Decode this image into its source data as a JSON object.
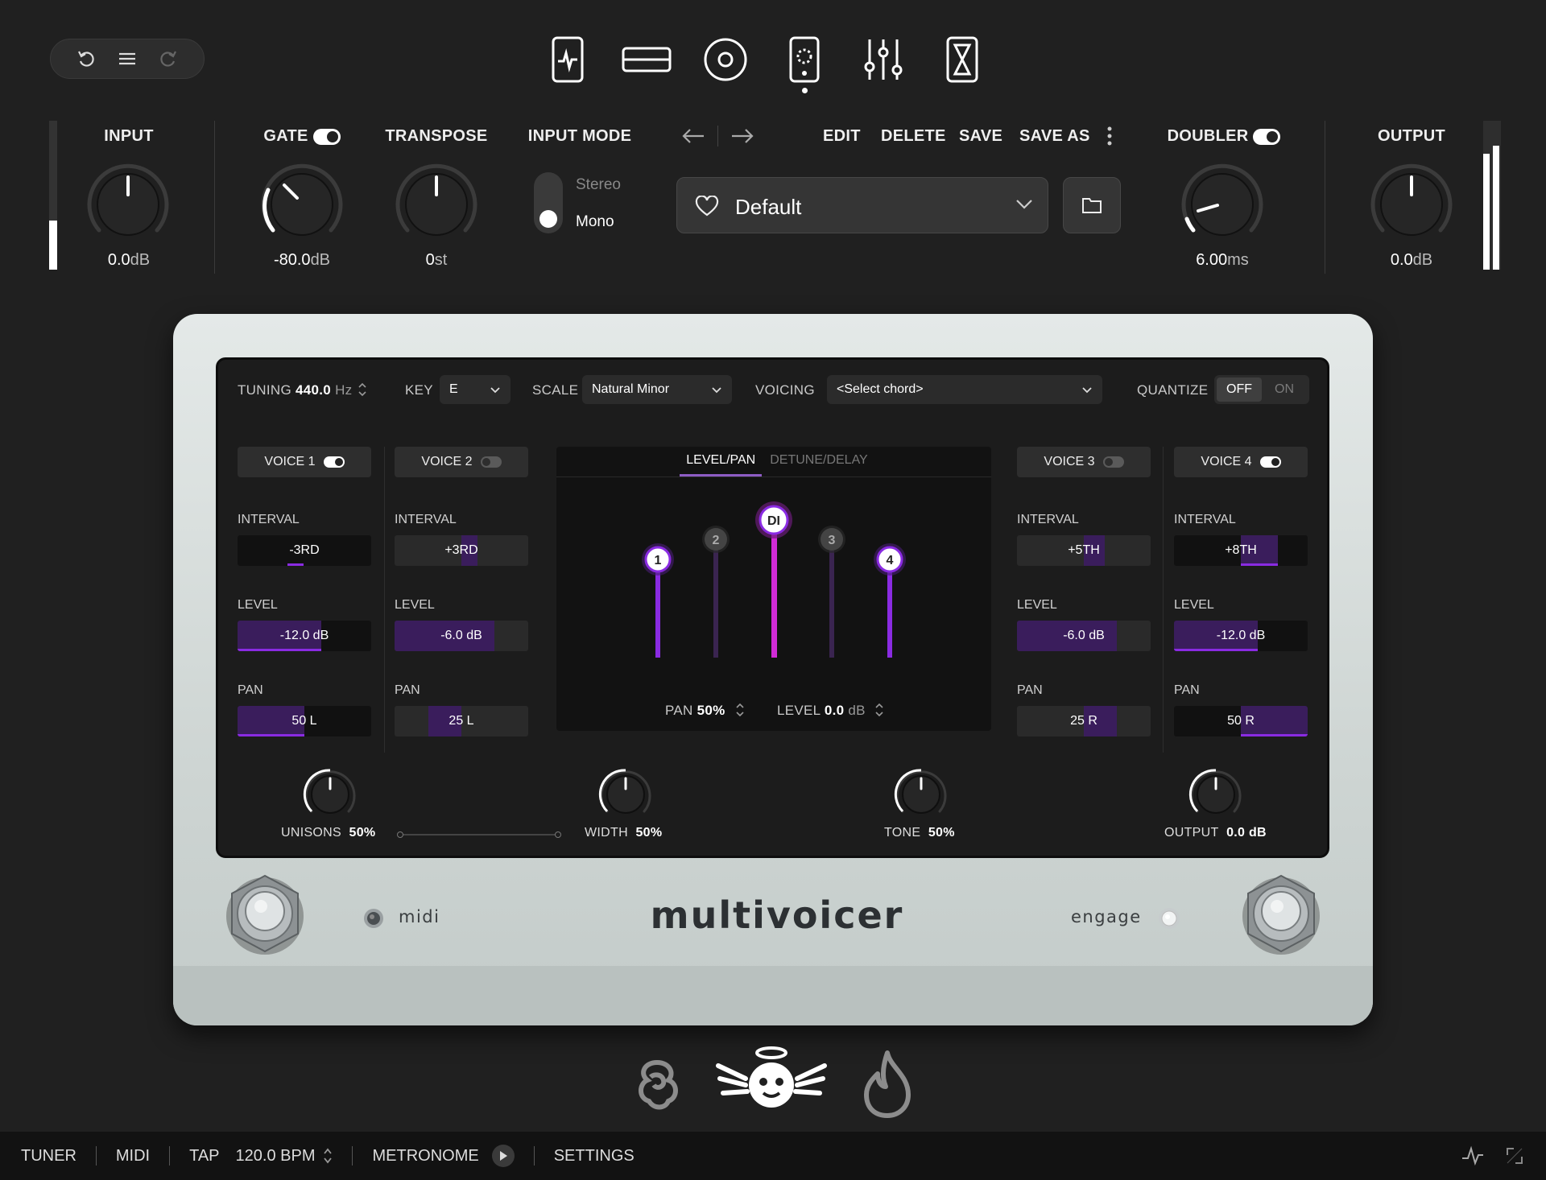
{
  "top": {
    "icons": [
      "undo-icon",
      "menu-icon",
      "redo-icon"
    ],
    "modules": [
      {
        "name": "pulse-module-icon"
      },
      {
        "name": "rack-module-icon"
      },
      {
        "name": "circle-module-icon"
      },
      {
        "name": "pedal-module-icon",
        "active": true
      },
      {
        "name": "mixer-module-icon"
      },
      {
        "name": "hourglass-module-icon"
      }
    ]
  },
  "controls": {
    "input": {
      "label": "INPUT",
      "value": "0.0",
      "unit": "dB",
      "meter_level": 0.33
    },
    "gate": {
      "label": "GATE",
      "value": "-80.0",
      "unit": "dB",
      "enabled": true
    },
    "transpose": {
      "label": "TRANSPOSE",
      "value": "0",
      "unit": "st"
    },
    "input_mode": {
      "label": "INPUT MODE",
      "options": [
        "Stereo",
        "Mono"
      ],
      "selected": "Mono"
    },
    "doubler": {
      "label": "DOUBLER",
      "value": "6.00",
      "unit": "ms",
      "enabled": true
    },
    "output": {
      "label": "OUTPUT",
      "value": "0.0",
      "unit": "dB",
      "meter_level": 0.78
    }
  },
  "preset": {
    "name": "Default",
    "actions": [
      "EDIT",
      "DELETE",
      "SAVE",
      "SAVE AS"
    ]
  },
  "screen": {
    "tuning_label": "TUNING",
    "tuning_value": "440.0",
    "tuning_unit": "Hz",
    "key_label": "KEY",
    "key_value": "E",
    "scale_label": "SCALE",
    "scale_value": "Natural Minor",
    "voicing_label": "VOICING",
    "voicing_value": "<Select chord>",
    "quantize_label": "QUANTIZE",
    "quantize_off": "OFF",
    "quantize_on": "ON",
    "field_labels": {
      "interval": "INTERVAL",
      "level": "LEVEL",
      "pan": "PAN"
    },
    "voices": [
      {
        "label": "VOICE 1",
        "enabled": true,
        "interval": "-3RD",
        "level": "-12.0 dB",
        "pan": "50 L"
      },
      {
        "label": "VOICE 2",
        "enabled": false,
        "interval": "+3RD",
        "level": "-6.0 dB",
        "pan": "25 L"
      },
      {
        "label": "VOICE 3",
        "enabled": false,
        "interval": "+5TH",
        "level": "-6.0 dB",
        "pan": "25 R"
      },
      {
        "label": "VOICE 4",
        "enabled": true,
        "interval": "+8TH",
        "level": "-12.0 dB",
        "pan": "50 R"
      }
    ],
    "mixer": {
      "tab_active": "LEVEL/PAN",
      "tab_inactive": "DETUNE/DELAY",
      "handles": [
        "1",
        "2",
        "DI",
        "3",
        "4"
      ],
      "pan_label": "PAN",
      "pan_value": "50%",
      "level_label": "LEVEL",
      "level_value": "0.0",
      "level_unit": "dB"
    },
    "knobs": [
      {
        "label": "UNISONS",
        "value": "50%"
      },
      {
        "label": "WIDTH",
        "value": "50%"
      },
      {
        "label": "TONE",
        "value": "50%"
      },
      {
        "label": "OUTPUT",
        "value": "0.0 dB"
      }
    ]
  },
  "pedal": {
    "brand": "multivoicer",
    "midi": "midi",
    "engage": "engage"
  },
  "characters": [
    "rose-icon",
    "angel-icon",
    "flame-icon"
  ],
  "status": {
    "tuner": "TUNER",
    "midi": "MIDI",
    "tap": "TAP",
    "bpm": "120.0 BPM",
    "metronome": "METRONOME",
    "settings": "SETTINGS"
  },
  "colors": {
    "accent": "#8a2be2",
    "di": "#d12bd6",
    "bg": "#202020",
    "pedal": "#d6dcda"
  }
}
